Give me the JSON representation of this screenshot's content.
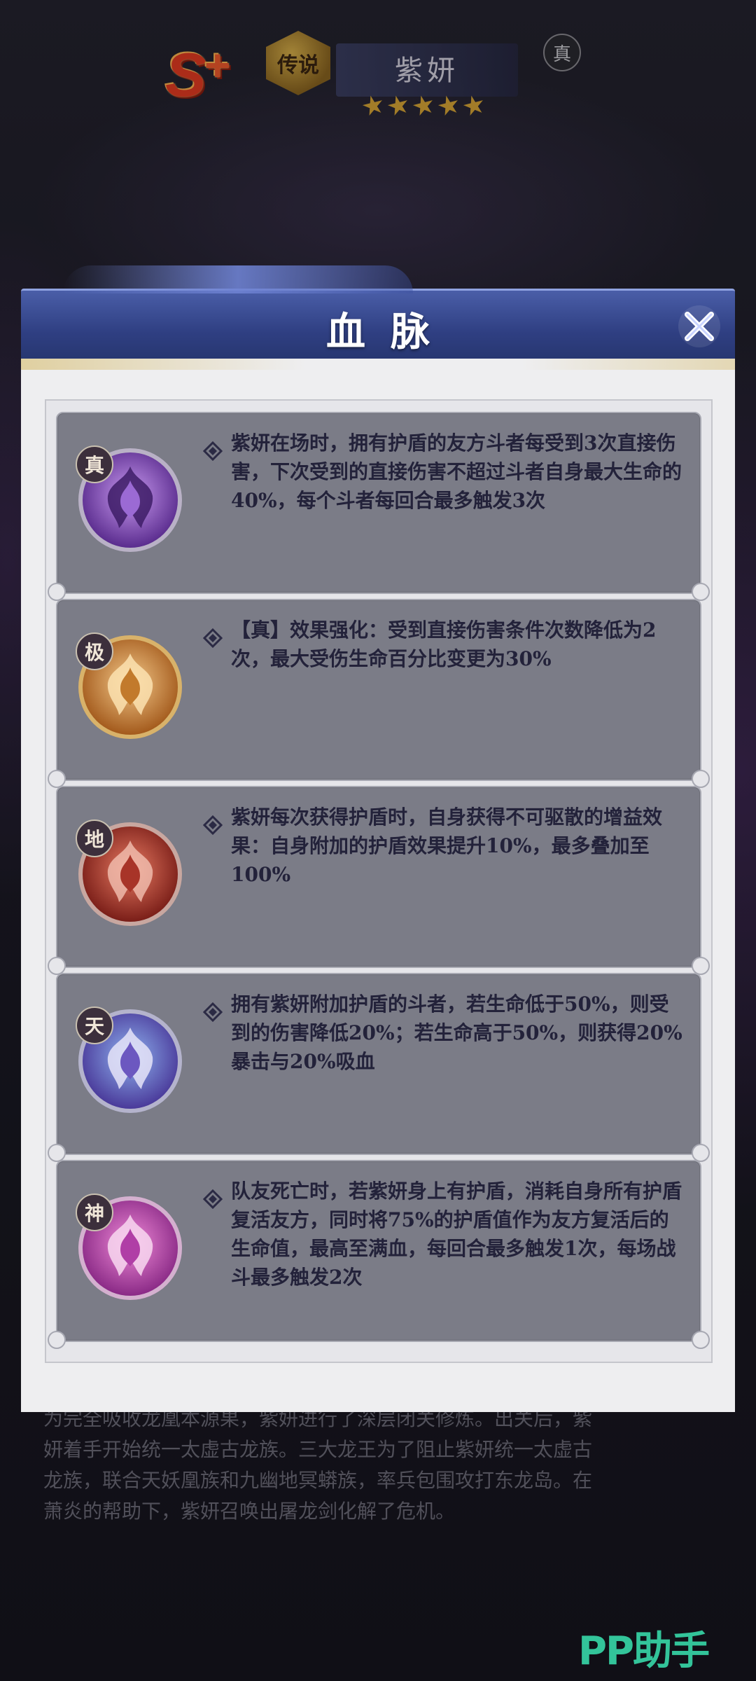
{
  "header": {
    "rank": "S",
    "rank_plus": "+",
    "rarity": "传说",
    "hero_name": "紫妍",
    "true_badge": "真",
    "star_count": 5
  },
  "modal": {
    "title": "血脉",
    "close_label": "✕"
  },
  "abilities": [
    {
      "tier": "真",
      "icon": "purple-flame-emblem-icon",
      "color": "#8a4fc2",
      "desc": "紫妍在场时，拥有护盾的友方斗者每受到3次直接伤害，下次受到的直接伤害不超过斗者自身最大生命的40%，每个斗者每回合最多触发3次"
    },
    {
      "tier": "极",
      "icon": "gold-flame-emblem-icon",
      "color": "#c88a3a",
      "desc": "【真】效果强化：受到直接伤害条件次数降低为2次，最大受伤生命百分比变更为30%"
    },
    {
      "tier": "地",
      "icon": "red-flame-emblem-icon",
      "color": "#b43c30",
      "desc": "紫妍每次获得护盾时，自身获得不可驱散的增益效果：自身附加的护盾效果提升10%，最多叠加至100%"
    },
    {
      "tier": "天",
      "icon": "blue-purple-flame-emblem-icon",
      "color": "#6a6fc8",
      "desc": "拥有紫妍附加护盾的斗者，若生命低于50%，则受到的伤害降低20%；若生命高于50%，则获得20%暴击与20%吸血"
    },
    {
      "tier": "神",
      "icon": "magenta-flame-emblem-icon",
      "color": "#c04fb4",
      "desc": "队友死亡时，若紫妍身上有护盾，消耗自身所有护盾复活友方，同时将75%的护盾值作为友方复活后的生命值，最高至满血，每回合最多触发1次，每场战斗最多触发2次"
    }
  ],
  "lore": {
    "line1": "为完全吸收龙凰本源果，紫妍进行了深层闭关修炼。出关后，紫",
    "line2": "妍着手开始统一太虚古龙族。三大龙王为了阻止紫妍统一太虚古",
    "line3": "龙族，联合天妖凰族和九幽地冥蟒族，率兵包围攻打东龙岛。在",
    "line4": "萧炎的帮助下，紫妍召唤出屠龙剑化解了危机。"
  },
  "watermark": "PP助手"
}
